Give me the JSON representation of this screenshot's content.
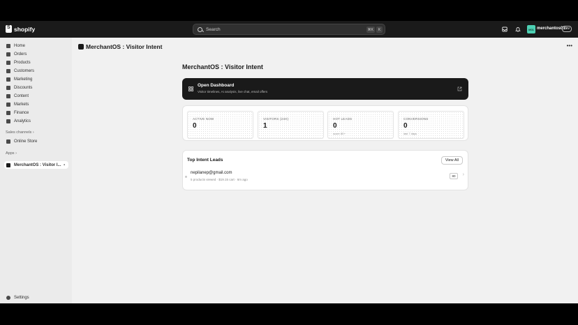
{
  "topbar": {
    "brand": "shopify",
    "search_placeholder": "Search",
    "shortcut_key1": "⌘K",
    "shortcut_key2": "K",
    "store_initials": "M01",
    "store_name": "merchantos01",
    "store_tag": "dev"
  },
  "sidebar": {
    "items": [
      {
        "label": "Home"
      },
      {
        "label": "Orders"
      },
      {
        "label": "Products"
      },
      {
        "label": "Customers"
      },
      {
        "label": "Marketing"
      },
      {
        "label": "Discounts"
      },
      {
        "label": "Content"
      },
      {
        "label": "Markets"
      },
      {
        "label": "Finance"
      },
      {
        "label": "Analytics"
      }
    ],
    "sales_channels_label": "Sales channels",
    "online_store_label": "Online Store",
    "apps_label": "Apps",
    "app_selected_label": "MerchantOS : Visitor I...",
    "settings_label": "Settings"
  },
  "header": {
    "title": "MerchantOS : Visitor Intent"
  },
  "page": {
    "title": "MerchantOS : Visitor Intent",
    "dashboard": {
      "title": "Open Dashboard",
      "subtitle": "Visitor timelines, AI analysis, live chat, email offers"
    },
    "stats": [
      {
        "label": "ACTIVE NOW",
        "value": "0",
        "sub": ""
      },
      {
        "label": "VISITORS (24H)",
        "value": "1",
        "sub": ""
      },
      {
        "label": "HOT LEADS",
        "value": "0",
        "sub": "score 80+"
      },
      {
        "label": "CONVERSIONS",
        "value": "0",
        "sub": "last 7 days"
      }
    ],
    "leads": {
      "title": "Top Intent Leads",
      "view_all": "View All",
      "rows": [
        {
          "email": "nepilanep@gmail.com",
          "meta": "5 products viewed · $19.15 cart · 6m ago",
          "score": "80"
        }
      ]
    }
  },
  "colors": {
    "topbar": "#1a1a1a",
    "sidebar": "#ebebeb",
    "main_bg": "#f1f1f1",
    "dashboard_card": "#1a1a1a"
  }
}
